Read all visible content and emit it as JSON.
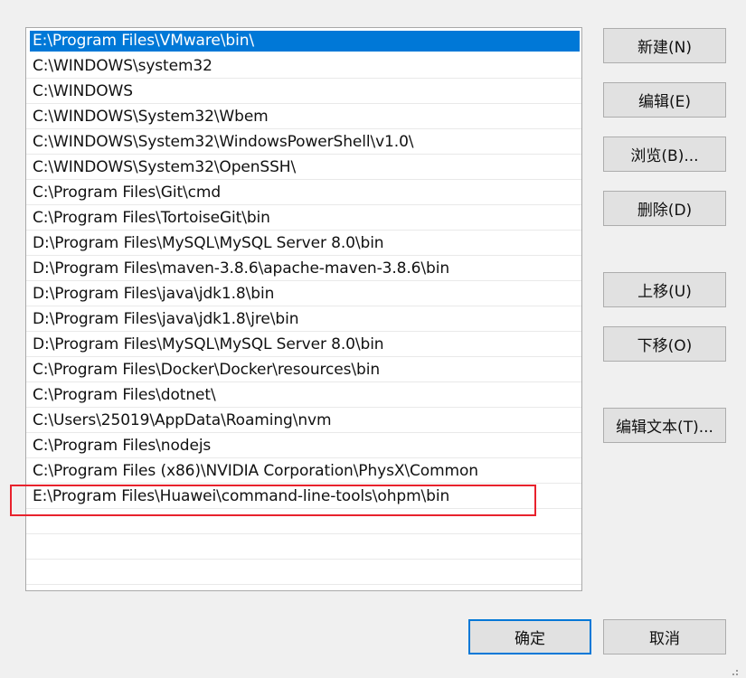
{
  "path_list": {
    "items": [
      "E:\\Program Files\\VMware\\bin\\",
      "C:\\WINDOWS\\system32",
      "C:\\WINDOWS",
      "C:\\WINDOWS\\System32\\Wbem",
      "C:\\WINDOWS\\System32\\WindowsPowerShell\\v1.0\\",
      "C:\\WINDOWS\\System32\\OpenSSH\\",
      "C:\\Program Files\\Git\\cmd",
      "C:\\Program Files\\TortoiseGit\\bin",
      "D:\\Program Files\\MySQL\\MySQL Server 8.0\\bin",
      "D:\\Program Files\\maven-3.8.6\\apache-maven-3.8.6\\bin",
      "D:\\Program Files\\java\\jdk1.8\\bin",
      "D:\\Program Files\\java\\jdk1.8\\jre\\bin",
      "D:\\Program Files\\MySQL\\MySQL Server 8.0\\bin",
      "C:\\Program Files\\Docker\\Docker\\resources\\bin",
      "C:\\Program Files\\dotnet\\",
      "C:\\Users\\25019\\AppData\\Roaming\\nvm",
      "C:\\Program Files\\nodejs",
      "C:\\Program Files (x86)\\NVIDIA Corporation\\PhysX\\Common",
      "E:\\Program Files\\Huawei\\command-line-tools\\ohpm\\bin",
      "",
      "",
      ""
    ],
    "selected_index": 0,
    "highlighted_index": 18
  },
  "buttons": {
    "new": "新建(N)",
    "edit": "编辑(E)",
    "browse": "浏览(B)...",
    "delete": "删除(D)",
    "move_up": "上移(U)",
    "move_down": "下移(O)",
    "edit_text": "编辑文本(T)...",
    "ok": "确定",
    "cancel": "取消"
  },
  "colors": {
    "selection": "#0078d7",
    "highlight_box": "#e8222d",
    "dialog_background": "#f0f0f0"
  }
}
